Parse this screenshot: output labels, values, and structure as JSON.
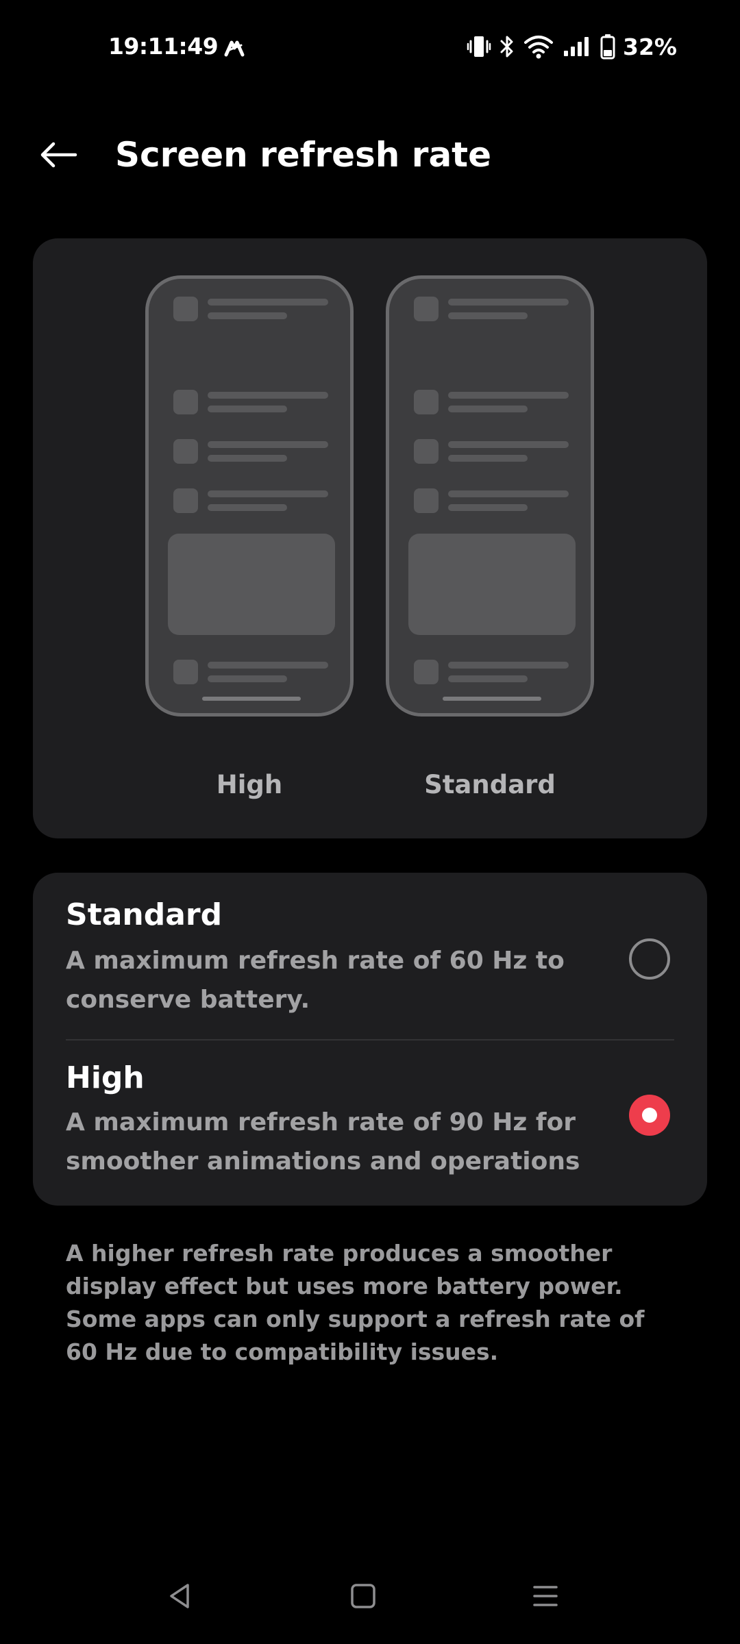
{
  "status_bar": {
    "time": "19:11:49",
    "battery_percent": "32%",
    "icons": [
      "app-notification-icon",
      "vibrate-icon",
      "bluetooth-icon",
      "wifi-icon",
      "signal-icon",
      "battery-icon"
    ]
  },
  "header": {
    "title": "Screen refresh rate",
    "back_icon": "arrow-left-icon"
  },
  "preview": {
    "high_label": "High",
    "standard_label": "Standard"
  },
  "options": [
    {
      "title": "Standard",
      "description": "A maximum refresh rate of 60 Hz to conserve battery.",
      "selected": false
    },
    {
      "title": "High",
      "description": "A maximum refresh rate of 90 Hz for smoother animations and operations",
      "selected": true
    }
  ],
  "footnote": "A higher refresh rate produces a smoother display effect but uses more battery power. Some apps can only support a refresh rate of 60 Hz due to compatibility issues.",
  "nav_bar": {
    "icons": [
      "nav-back-icon",
      "nav-home-icon",
      "nav-menu-icon"
    ]
  },
  "colors": {
    "background": "#000000",
    "card": "#1e1e20",
    "accent": "#ee3d4c",
    "secondary_text": "#a2a2a4"
  }
}
